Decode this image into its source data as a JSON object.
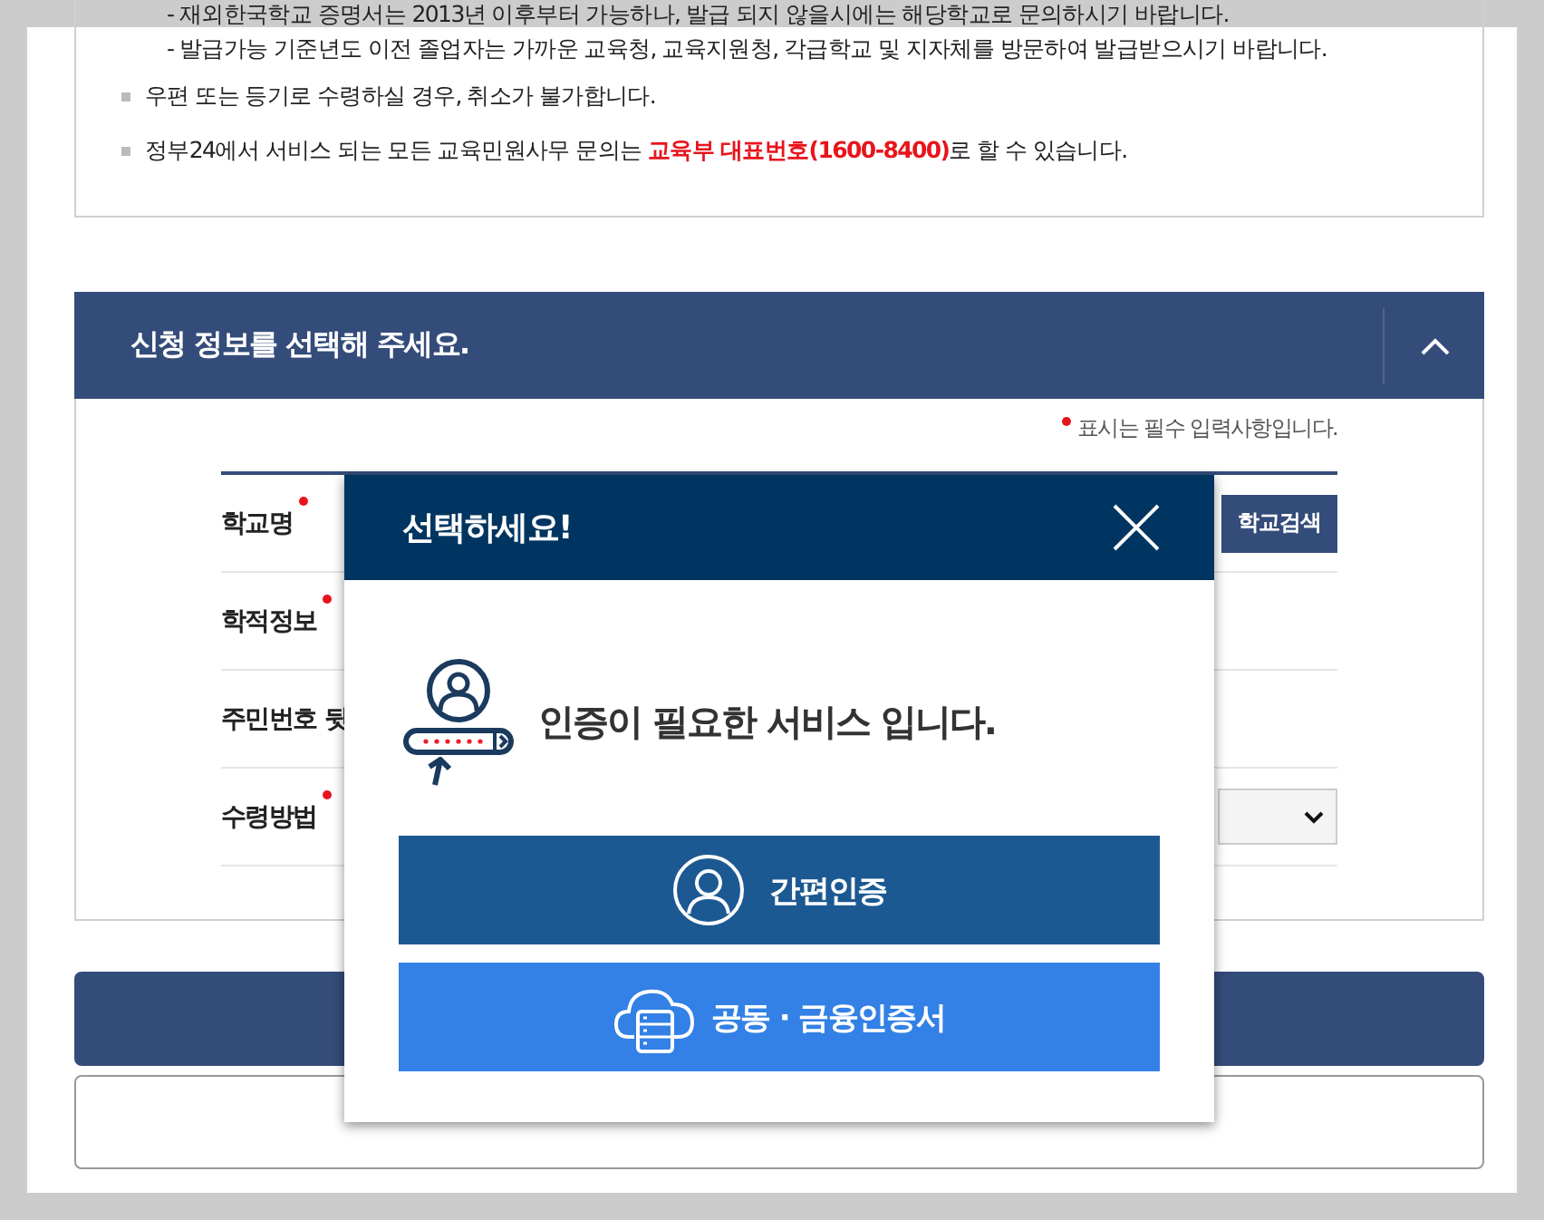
{
  "notices": [
    {
      "kind": "sub",
      "text": "- 재외한국학교 증명서는 2013년 이후부터 가능하나, 발급 되지 않을시에는 해당학교로 문의하시기 바랍니다."
    },
    {
      "kind": "sub",
      "text": "- 발급가능 기준년도 이전 졸업자는 가까운 교육청, 교육지원청, 각급학교 및 지자체를 방문하여 발급받으시기 바랍니다."
    },
    {
      "kind": "bullet",
      "text": "우편 또는 등기로 수령하실 경우, 취소가 불가합니다."
    },
    {
      "kind": "bullet",
      "text": "정부24에서 서비스 되는 모든 교육민원사무 문의는 **교육부 대표번호(1600-8400)**로 할 수 있습니다."
    }
  ],
  "section": {
    "title": "신청 정보를 선택해 주세요.",
    "expanded": true
  },
  "required_note": "표시는 필수 입력사항입니다.",
  "form_rows": [
    {
      "label": "학교명",
      "required": true,
      "kind": "button",
      "button": "학교검색"
    },
    {
      "label": "학적정보",
      "required": true,
      "kind": "blank"
    },
    {
      "label": "주민번호 뒷",
      "kind": "blank"
    },
    {
      "label": "수령방법",
      "required": true,
      "kind": "select"
    }
  ],
  "modal": {
    "title": "선택하세요!",
    "message": "인증이 필요한 서비스 입니다.",
    "options": [
      {
        "label": "간편인증",
        "kind": "simple"
      },
      {
        "label": "공동 · 금융인증서",
        "kind": "certificate"
      }
    ]
  }
}
